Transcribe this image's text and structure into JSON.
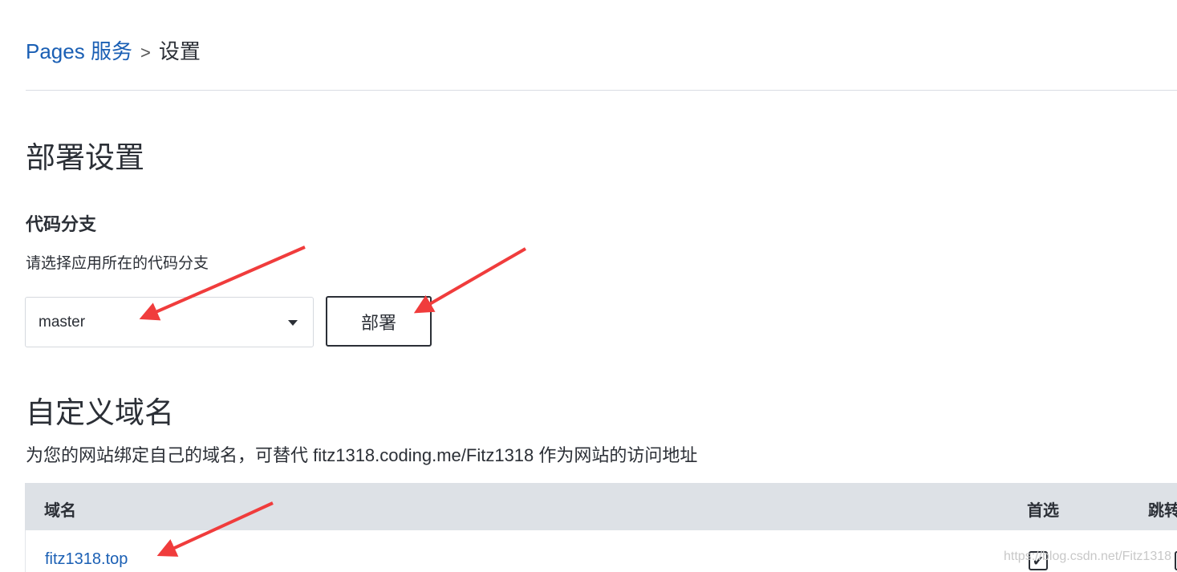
{
  "breadcrumb": {
    "parent": "Pages 服务",
    "separator": ">",
    "current": "设置"
  },
  "deploy": {
    "title": "部署设置",
    "branch_label": "代码分支",
    "branch_desc": "请选择应用所在的代码分支",
    "branch_value": "master",
    "deploy_button": "部署"
  },
  "custom_domain": {
    "title": "自定义域名",
    "desc": "为您的网站绑定自己的域名，可替代 fitz1318.coding.me/Fitz1318 作为网站的访问地址",
    "columns": [
      "域名",
      "首选",
      "跳转"
    ],
    "rows": [
      {
        "domain": "fitz1318.top",
        "primary": true,
        "redirect": false
      }
    ]
  },
  "watermark": "https://blog.csdn.net/Fitz1318",
  "colors": {
    "link": "#1a5fb4",
    "annotation_arrow": "#f03c3c",
    "table_header_bg": "#dde1e6"
  }
}
